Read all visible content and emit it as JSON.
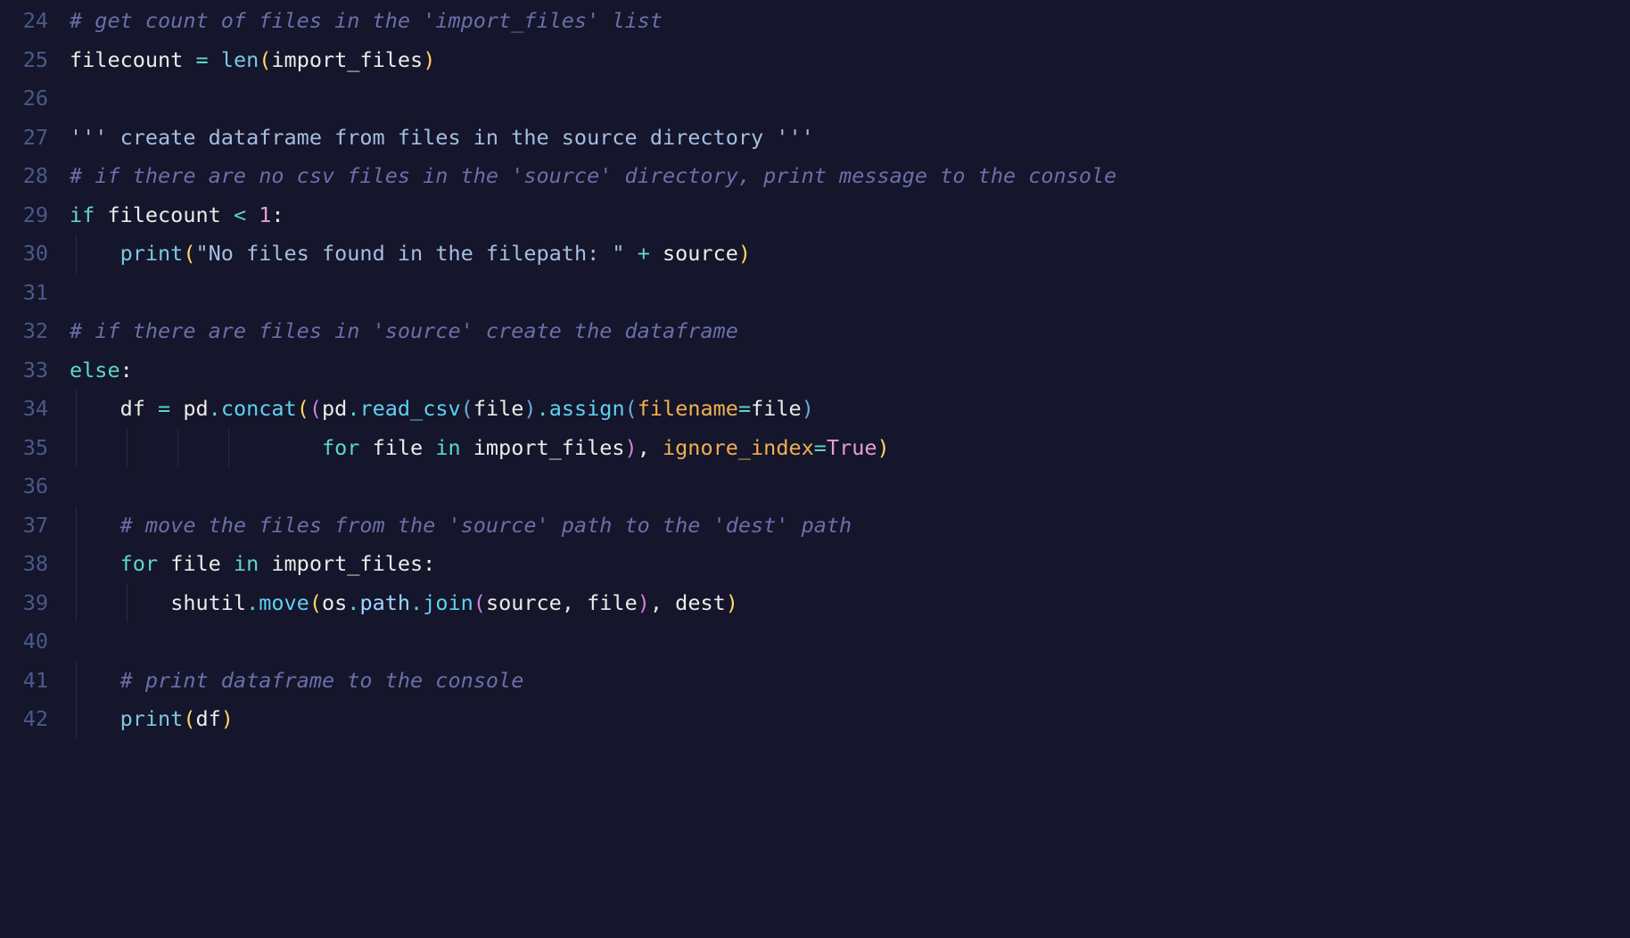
{
  "editor": {
    "startLine": 24,
    "lines": [
      {
        "num": 24,
        "indent": 0,
        "guides": [],
        "tokens": [
          {
            "cls": "tok-comment",
            "t": "# get count of files in the 'import_files' list"
          }
        ]
      },
      {
        "num": 25,
        "indent": 0,
        "guides": [],
        "tokens": [
          {
            "cls": "tok-var",
            "t": "filecount "
          },
          {
            "cls": "tok-operator",
            "t": "="
          },
          {
            "cls": "tok-var",
            "t": " "
          },
          {
            "cls": "tok-builtin",
            "t": "len"
          },
          {
            "cls": "tok-bracket1",
            "t": "("
          },
          {
            "cls": "tok-var",
            "t": "import_files"
          },
          {
            "cls": "tok-bracket1",
            "t": ")"
          }
        ]
      },
      {
        "num": 26,
        "indent": 0,
        "guides": [],
        "tokens": []
      },
      {
        "num": 27,
        "indent": 0,
        "guides": [],
        "tokens": [
          {
            "cls": "tok-docstring",
            "t": "''' create dataframe from files in the source directory '''"
          }
        ]
      },
      {
        "num": 28,
        "indent": 0,
        "guides": [],
        "tokens": [
          {
            "cls": "tok-comment",
            "t": "# if there are no csv files in the 'source' directory, print message to the console"
          }
        ]
      },
      {
        "num": 29,
        "indent": 0,
        "guides": [],
        "tokens": [
          {
            "cls": "tok-keyword2",
            "t": "if"
          },
          {
            "cls": "tok-var",
            "t": " filecount "
          },
          {
            "cls": "tok-operator",
            "t": "<"
          },
          {
            "cls": "tok-var",
            "t": " "
          },
          {
            "cls": "tok-number",
            "t": "1"
          },
          {
            "cls": "tok-var",
            "t": ":"
          }
        ]
      },
      {
        "num": 30,
        "indent": 1,
        "guides": [
          0
        ],
        "tokens": [
          {
            "cls": "tok-builtin",
            "t": "print"
          },
          {
            "cls": "tok-bracket1",
            "t": "("
          },
          {
            "cls": "tok-string",
            "t": "\"No files found in the filepath: \""
          },
          {
            "cls": "tok-var",
            "t": " "
          },
          {
            "cls": "tok-operator",
            "t": "+"
          },
          {
            "cls": "tok-var",
            "t": " source"
          },
          {
            "cls": "tok-bracket1",
            "t": ")"
          }
        ]
      },
      {
        "num": 31,
        "indent": 0,
        "guides": [],
        "tokens": []
      },
      {
        "num": 32,
        "indent": 0,
        "guides": [],
        "tokens": [
          {
            "cls": "tok-comment",
            "t": "# if there are files in 'source' create the dataframe"
          }
        ]
      },
      {
        "num": 33,
        "indent": 0,
        "guides": [],
        "tokens": [
          {
            "cls": "tok-keyword2",
            "t": "else"
          },
          {
            "cls": "tok-var",
            "t": ":"
          }
        ]
      },
      {
        "num": 34,
        "indent": 1,
        "guides": [
          0
        ],
        "tokens": [
          {
            "cls": "tok-var",
            "t": "df "
          },
          {
            "cls": "tok-operator",
            "t": "="
          },
          {
            "cls": "tok-var",
            "t": " pd"
          },
          {
            "cls": "tok-operator",
            "t": "."
          },
          {
            "cls": "tok-func",
            "t": "concat"
          },
          {
            "cls": "tok-bracket1",
            "t": "("
          },
          {
            "cls": "tok-bracket2",
            "t": "("
          },
          {
            "cls": "tok-var",
            "t": "pd"
          },
          {
            "cls": "tok-operator",
            "t": "."
          },
          {
            "cls": "tok-func",
            "t": "read_csv"
          },
          {
            "cls": "tok-bracket3",
            "t": "("
          },
          {
            "cls": "tok-var",
            "t": "file"
          },
          {
            "cls": "tok-bracket3",
            "t": ")"
          },
          {
            "cls": "tok-operator",
            "t": "."
          },
          {
            "cls": "tok-func",
            "t": "assign"
          },
          {
            "cls": "tok-bracket3",
            "t": "("
          },
          {
            "cls": "tok-param2",
            "t": "filename"
          },
          {
            "cls": "tok-operator",
            "t": "="
          },
          {
            "cls": "tok-var",
            "t": "file"
          },
          {
            "cls": "tok-bracket3",
            "t": ")"
          }
        ]
      },
      {
        "num": 35,
        "indent": 0,
        "guides": [
          0,
          1,
          2,
          3
        ],
        "raw_prefix": "                    ",
        "tokens": [
          {
            "cls": "tok-keyword2",
            "t": "for"
          },
          {
            "cls": "tok-var",
            "t": " file "
          },
          {
            "cls": "tok-keyword2",
            "t": "in"
          },
          {
            "cls": "tok-var",
            "t": " import_files"
          },
          {
            "cls": "tok-bracket2",
            "t": ")"
          },
          {
            "cls": "tok-var",
            "t": ", "
          },
          {
            "cls": "tok-param2",
            "t": "ignore_index"
          },
          {
            "cls": "tok-operator",
            "t": "="
          },
          {
            "cls": "tok-bool",
            "t": "True"
          },
          {
            "cls": "tok-bracket1",
            "t": ")"
          }
        ]
      },
      {
        "num": 36,
        "indent": 0,
        "guides": [],
        "tokens": []
      },
      {
        "num": 37,
        "indent": 1,
        "guides": [
          0
        ],
        "tokens": [
          {
            "cls": "tok-comment",
            "t": "# move the files from the 'source' path to the 'dest' path"
          }
        ]
      },
      {
        "num": 38,
        "indent": 1,
        "guides": [
          0
        ],
        "tokens": [
          {
            "cls": "tok-keyword2",
            "t": "for"
          },
          {
            "cls": "tok-var",
            "t": " file "
          },
          {
            "cls": "tok-keyword2",
            "t": "in"
          },
          {
            "cls": "tok-var",
            "t": " import_files:"
          }
        ]
      },
      {
        "num": 39,
        "indent": 2,
        "guides": [
          0,
          1
        ],
        "tokens": [
          {
            "cls": "tok-var",
            "t": "shutil"
          },
          {
            "cls": "tok-operator",
            "t": "."
          },
          {
            "cls": "tok-func",
            "t": "move"
          },
          {
            "cls": "tok-bracket1",
            "t": "("
          },
          {
            "cls": "tok-var",
            "t": "os"
          },
          {
            "cls": "tok-operator",
            "t": "."
          },
          {
            "cls": "tok-attr",
            "t": "path"
          },
          {
            "cls": "tok-operator",
            "t": "."
          },
          {
            "cls": "tok-func",
            "t": "join"
          },
          {
            "cls": "tok-bracket2",
            "t": "("
          },
          {
            "cls": "tok-var",
            "t": "source, file"
          },
          {
            "cls": "tok-bracket2",
            "t": ")"
          },
          {
            "cls": "tok-var",
            "t": ", dest"
          },
          {
            "cls": "tok-bracket1",
            "t": ")"
          }
        ]
      },
      {
        "num": 40,
        "indent": 0,
        "guides": [],
        "tokens": []
      },
      {
        "num": 41,
        "indent": 1,
        "guides": [
          0
        ],
        "tokens": [
          {
            "cls": "tok-comment",
            "t": "# print dataframe to the console"
          }
        ]
      },
      {
        "num": 42,
        "indent": 1,
        "guides": [
          0
        ],
        "tokens": [
          {
            "cls": "tok-builtin",
            "t": "print"
          },
          {
            "cls": "tok-bracket1",
            "t": "("
          },
          {
            "cls": "tok-var",
            "t": "df"
          },
          {
            "cls": "tok-bracket1",
            "t": ")"
          }
        ]
      }
    ]
  },
  "colors": {
    "background": "#15152b",
    "gutter": "#4a5a8a",
    "comment": "#6b6fa8",
    "string": "#a4bee0",
    "keyword": "#5dd6c8",
    "builtin": "#7bc8e0",
    "func": "#5fd1f0",
    "number": "#e39fd8",
    "bracket1": "#ffd866",
    "bracket2": "#d080d8",
    "bracket3": "#6fa8dc",
    "param": "#f0b050",
    "bool": "#e39fd8",
    "identifier": "#ecebe8"
  }
}
